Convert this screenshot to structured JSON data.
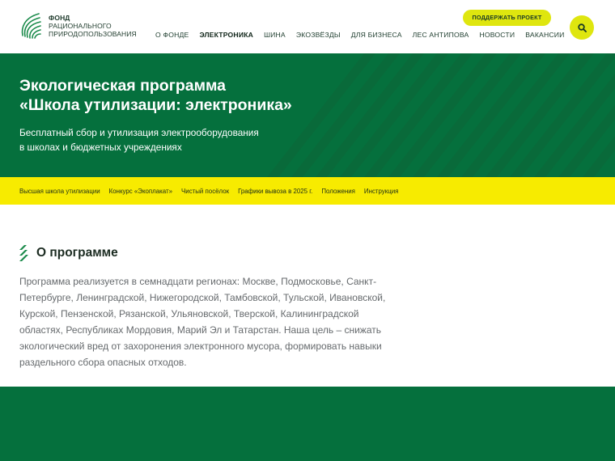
{
  "logo": {
    "line1": "ФОНД",
    "line2": "РАЦИОНАЛЬНОГО",
    "line3": "ПРИРОДОПОЛЬЗОВАНИЯ",
    "icon": "fingerprint-leaf-icon"
  },
  "header": {
    "support_label": "ПОДДЕРЖАТЬ ПРОЕКТ",
    "search_icon": "search-icon"
  },
  "nav": {
    "items": [
      {
        "label": "О ФОНДЕ"
      },
      {
        "label": "ЭЛЕКТРОНИКА"
      },
      {
        "label": "ШИНА"
      },
      {
        "label": "ЭКОЗВЁЗДЫ"
      },
      {
        "label": "ДЛЯ БИЗНЕСА"
      },
      {
        "label": "ЛЕС АНТИПОВА"
      },
      {
        "label": "НОВОСТИ"
      },
      {
        "label": "ВАКАНСИИ"
      }
    ],
    "active": "ЭЛЕКТРОНИКА"
  },
  "hero": {
    "title_line1": "Экологическая программа",
    "title_line2": "«Школа утилизации: электроника»",
    "subtitle_line1": "Бесплатный сбор и утилизация электрооборудования",
    "subtitle_line2": "в школах и бюджетных учреждениях"
  },
  "subnav": {
    "items": [
      {
        "label": "Высшая школа утилизации"
      },
      {
        "label": "Конкурс «Экоплакат»"
      },
      {
        "label": "Чистый посёлок"
      },
      {
        "label": "Графики вывоза в 2025 г."
      },
      {
        "label": "Положения"
      },
      {
        "label": "Инструкция"
      }
    ]
  },
  "about": {
    "title": "О программе",
    "text": "Программа реализуется в семнадцати регионах: Москве, Подмосковье, Санкт-Петербурге, Ленинградской, Нижегородской, Тамбовской, Тульской, Ивановской, Курской, Пензенской, Рязанской, Ульяновской, Тверской, Калининградской областях, Республиках Мордовия, Марий Эл и Татарстан. Наша цель – снижать экологический вред от захоронения электронного мусора, формировать навыки раздельного сбора опасных отходов."
  },
  "colors": {
    "brand_green": "#05703d",
    "accent_yellow": "#f7eb00",
    "button_yellow": "#dfe60f"
  }
}
